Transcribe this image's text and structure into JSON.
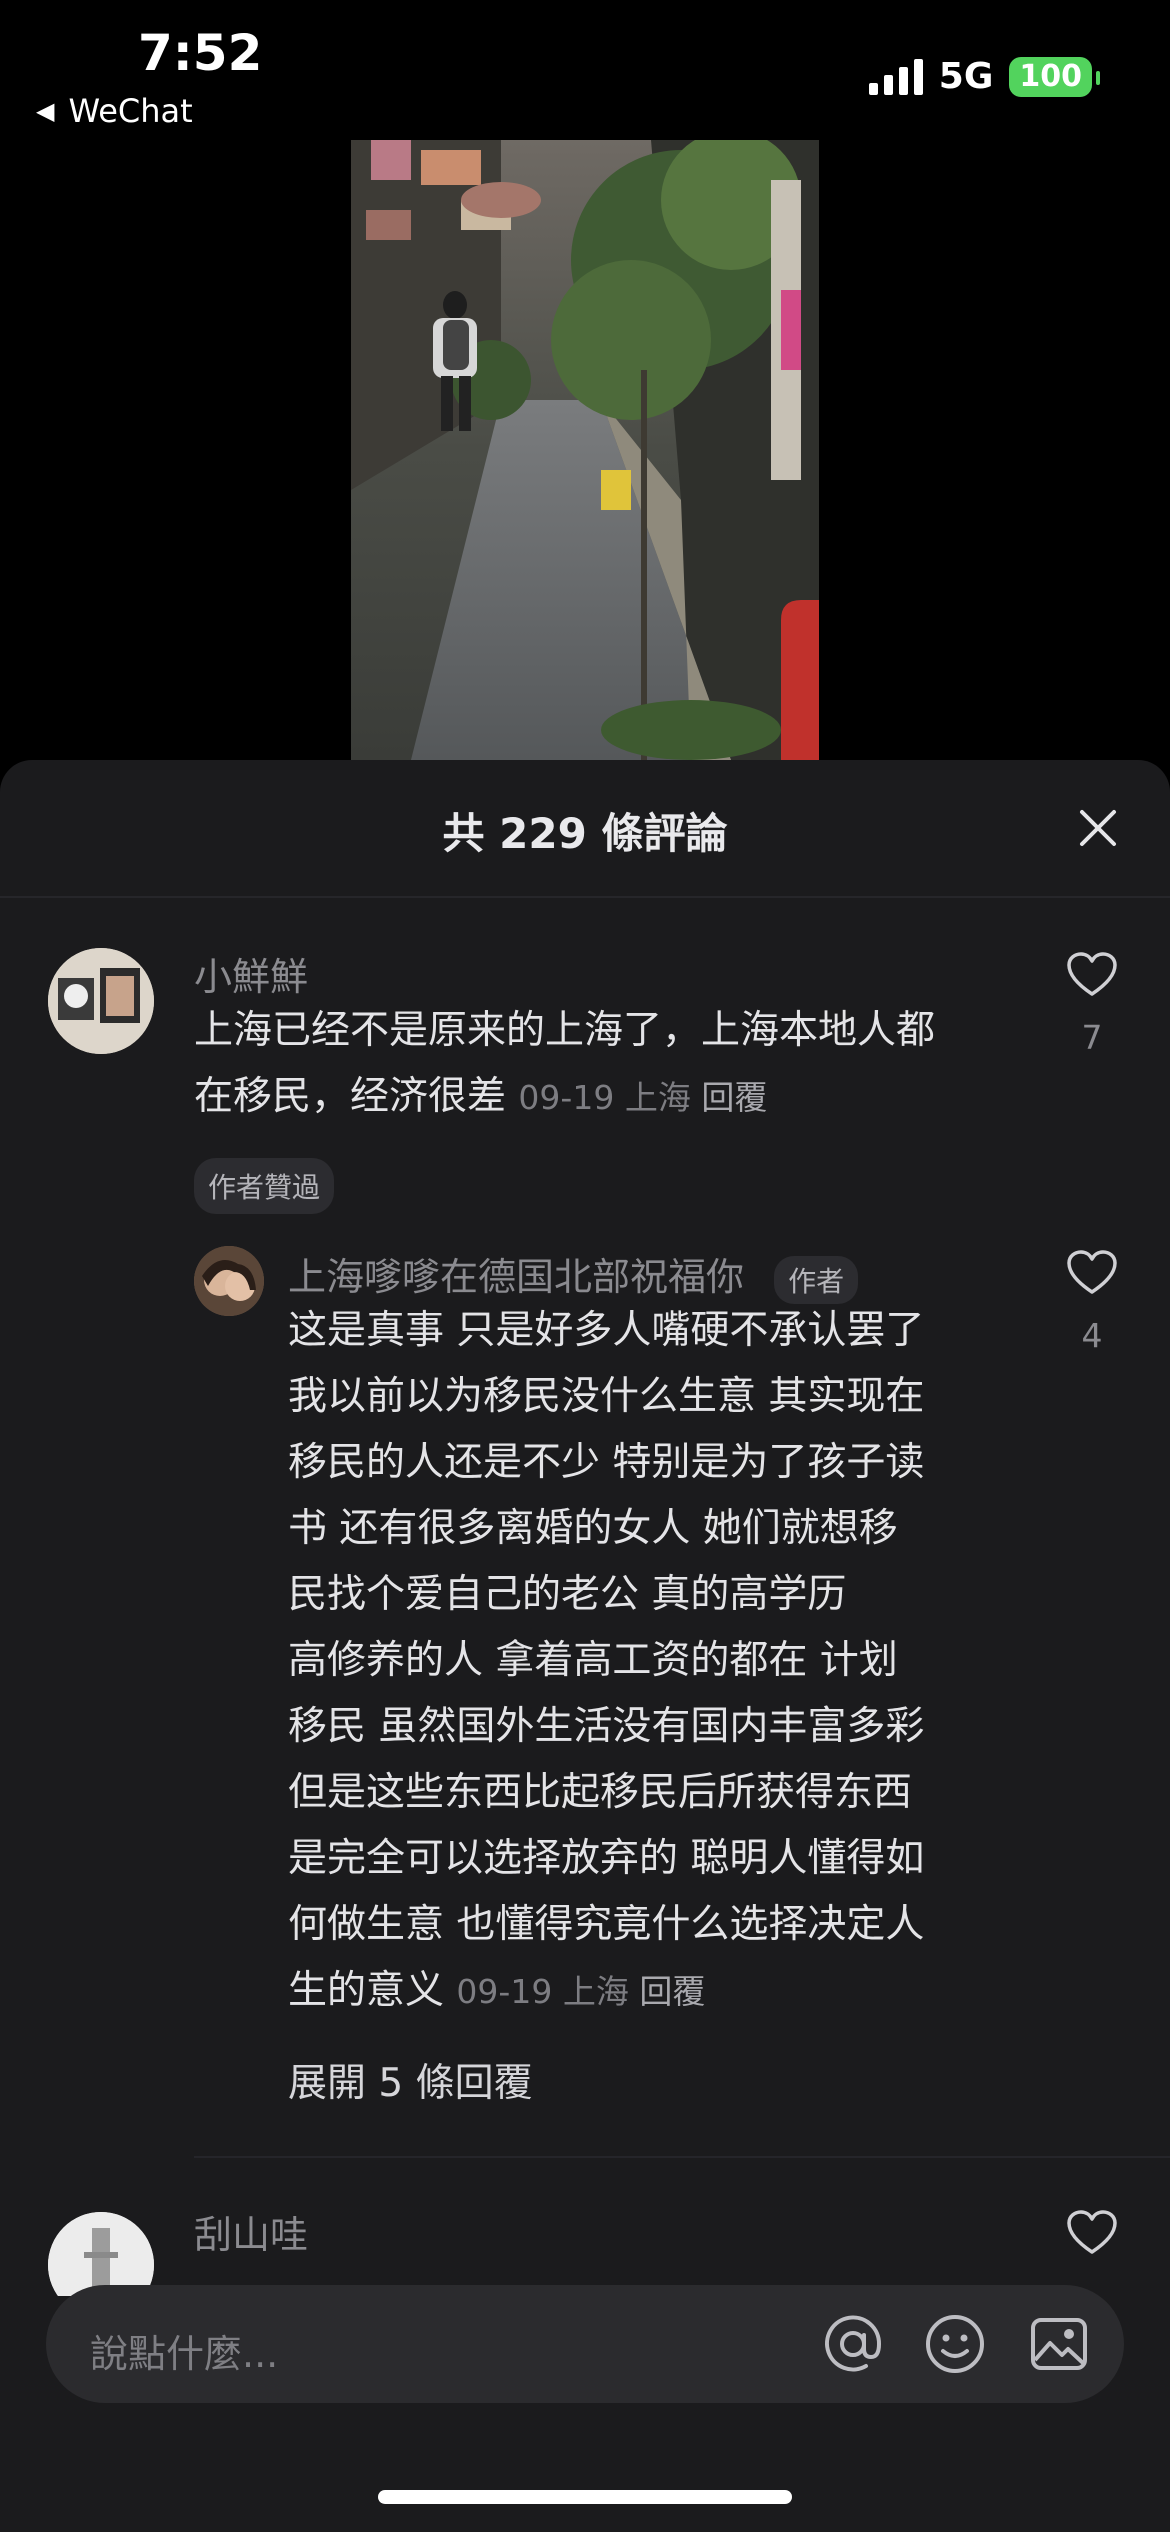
{
  "status_bar": {
    "time": "7:52",
    "back_app": "WeChat",
    "network": "5G",
    "battery": "100"
  },
  "sheet": {
    "title": "共 229 條評論"
  },
  "comments": [
    {
      "user": "小鮮鮮",
      "text_lines": [
        "上海已经不是原来的上海了，上海本地人都",
        "在移民，经济很差"
      ],
      "date": "09-19",
      "location": "上海",
      "reply": "回覆",
      "badge": "作者贊過",
      "likes": "7"
    }
  ],
  "reply": {
    "user": "上海嗲嗲在德国北部祝福你",
    "author_badge": "作者",
    "text_lines": [
      "这是真事  只是好多人嘴硬不承认罢了",
      "我以前以为移民没什么生意  其实现在",
      "移民的人还是不少  特别是为了孩子读",
      "书   还有很多离婚的女人    她们就想移",
      "民找个爱自己的老公       真的高学历",
      "高修养的人  拿着高工资的都在 计划",
      "移民  虽然国外生活没有国内丰富多彩",
      "但是这些东西比起移民后所获得东西",
      "是完全可以选择放弃的    聪明人懂得如",
      "何做生意  也懂得究竟什么选择决定人",
      "生的意义"
    ],
    "date": "09-19",
    "location": "上海",
    "reply_label": "回覆",
    "likes": "4",
    "expand": "展開 5 條回覆"
  },
  "next_comment": {
    "user": "刮山哇"
  },
  "input": {
    "placeholder": "說點什麼..."
  },
  "colors": {
    "sheet_bg": "#1b1b1d",
    "battery": "#52d35d"
  }
}
